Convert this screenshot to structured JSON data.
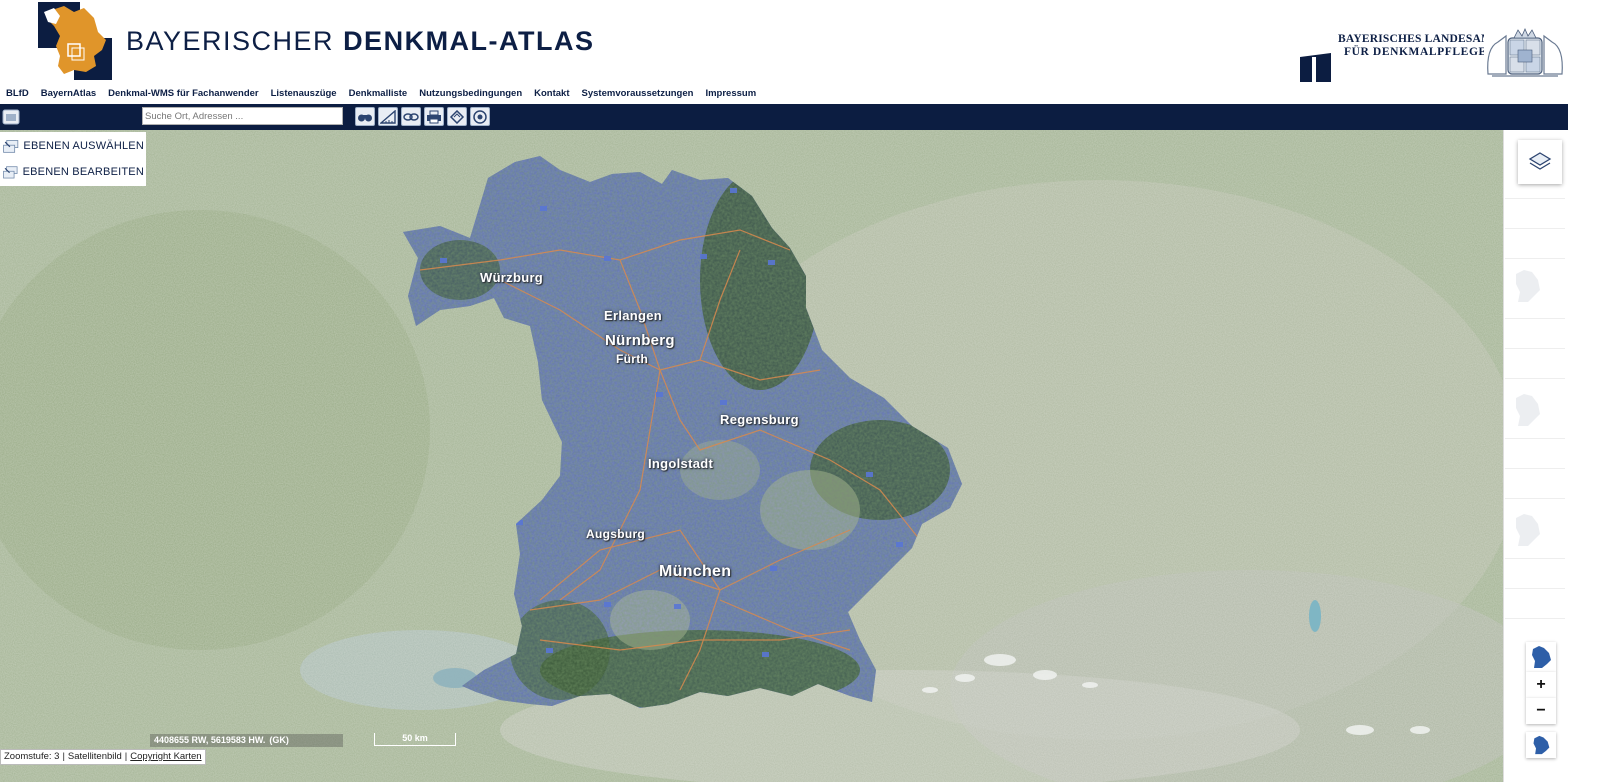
{
  "header": {
    "title_light": "BAYERISCHER",
    "title_bold": "DENKMAL-ATLAS",
    "agency_line1": "BAYERISCHES LANDESAMT",
    "agency_line2": "FÜR DENKMALPFLEGE",
    "brand_color": "#0c1d41",
    "accent_color": "#e0952a"
  },
  "nav": {
    "items": [
      {
        "label": "BLfD"
      },
      {
        "label": "BayernAtlas"
      },
      {
        "label": "Denkmal-WMS für Fachanwender"
      },
      {
        "label": "Listenauszüge"
      },
      {
        "label": "Denkmalliste"
      },
      {
        "label": "Nutzungsbedingungen"
      },
      {
        "label": "Kontakt"
      },
      {
        "label": "Systemvoraussetzungen"
      },
      {
        "label": "Impressum"
      }
    ]
  },
  "toolbar": {
    "search_placeholder": "Suche Ort, Adressen ...",
    "search_value": "",
    "tools": [
      "binoculars-icon",
      "measure-icon",
      "link-icon",
      "print-icon",
      "draw-icon",
      "help-icon"
    ]
  },
  "layers_panel": {
    "select_label": "EBENEN AUSWÄHLEN",
    "edit_label": "EBENEN BEARBEITEN"
  },
  "map": {
    "cities": [
      {
        "name": "Würzburg"
      },
      {
        "name": "Erlangen"
      },
      {
        "name": "Nürnberg"
      },
      {
        "name": "Fürth"
      },
      {
        "name": "Regensburg"
      },
      {
        "name": "Ingolstadt"
      },
      {
        "name": "Augsburg"
      },
      {
        "name": "München"
      }
    ]
  },
  "right_panel": {
    "zoom_in": "+",
    "zoom_out": "−"
  },
  "status": {
    "coordinates": "4408655 RW, 5619583 HW.",
    "crs": "(GK)",
    "scale": "50 km",
    "zoom_level": "Zoomstufe: 3",
    "basemap": "Satellitenbild",
    "copyright": "Copyright Karten"
  }
}
